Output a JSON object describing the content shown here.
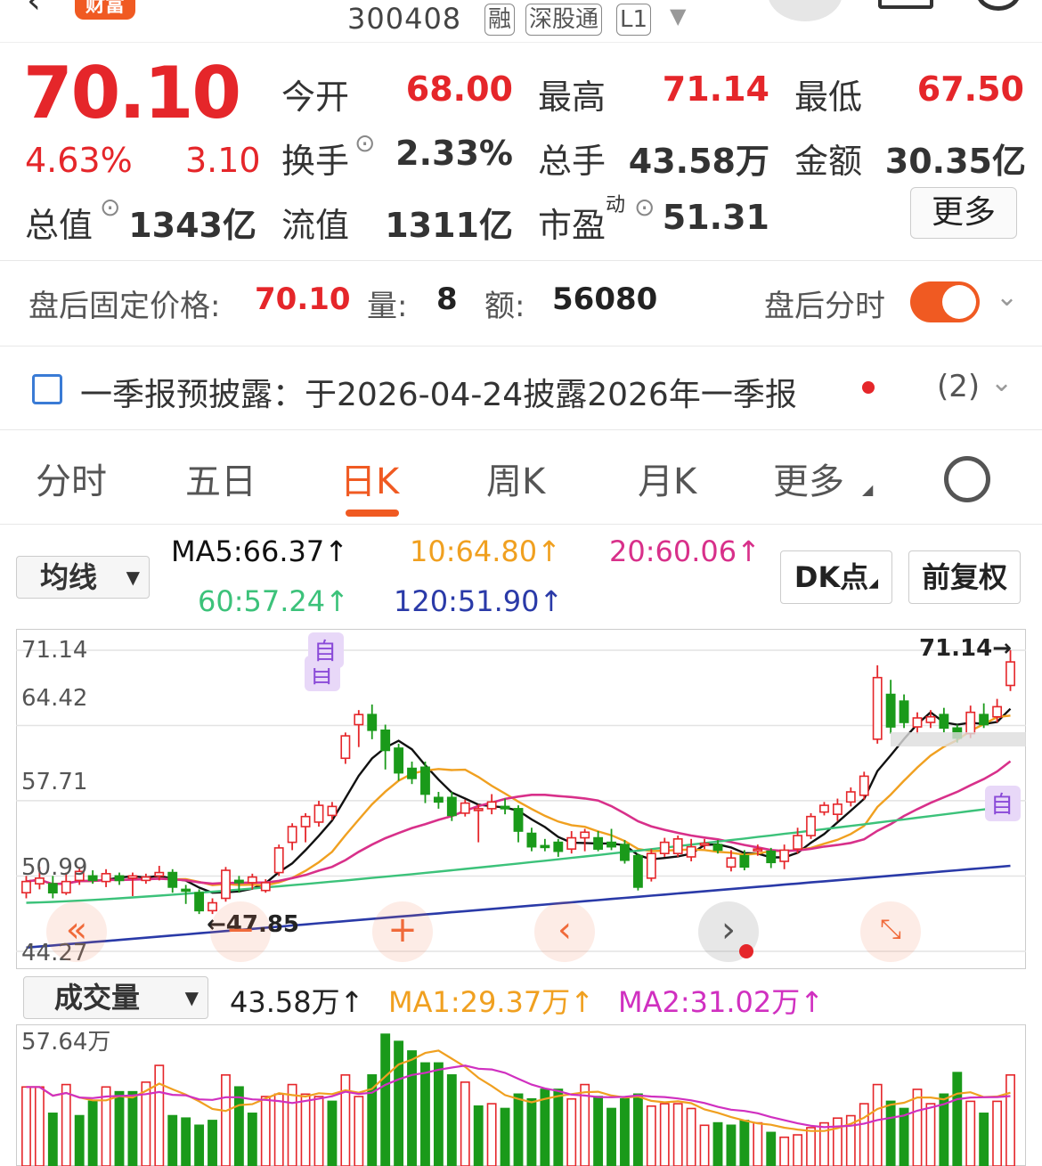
{
  "header": {
    "badge": "财富",
    "stock_code": "300408",
    "tags": [
      "融",
      "深股通",
      "L1"
    ]
  },
  "quote": {
    "price": "70.10",
    "change_pct": "4.63%",
    "change": "3.10",
    "fields": [
      {
        "label": "今开",
        "value": "68.00",
        "color": "red"
      },
      {
        "label": "最高",
        "value": "71.14",
        "color": "red"
      },
      {
        "label": "最低",
        "value": "67.50",
        "color": "red"
      },
      {
        "label": "换手",
        "value": "2.33%",
        "color": "dark"
      },
      {
        "label": "总手",
        "value": "43.58万",
        "color": "dark"
      },
      {
        "label": "金额",
        "value": "30.35亿",
        "color": "dark"
      },
      {
        "label": "总值",
        "value": "1343亿",
        "color": "dark"
      },
      {
        "label": "流值",
        "value": "1311亿",
        "color": "dark"
      },
      {
        "label": "市盈",
        "value": "51.31",
        "color": "dark"
      }
    ],
    "pe_superscript": "动",
    "more_label": "更多"
  },
  "after_hours": {
    "label": "盘后固定价格:",
    "price": "70.10",
    "vol_label": "量:",
    "vol": "8",
    "amount_label": "额:",
    "amount": "56080",
    "timeshare_label": "盘后分时",
    "toggle_on": true
  },
  "notice": {
    "text": "一季报预披露：于2026-04-24披露2026年一季报",
    "count": "(2)"
  },
  "tabs": [
    "分时",
    "五日",
    "日K",
    "周K",
    "月K",
    "更多"
  ],
  "active_tab": "日K",
  "ma_legend": {
    "dropdown": "均线",
    "ma5": "MA5:66.37↑",
    "ma10": "10:64.80↑",
    "ma20": "20:60.06↑",
    "ma60": "60:57.24↑",
    "ma120": "120:51.90↑",
    "dk_label": "DK点",
    "adjust_label": "前复权",
    "colors": {
      "ma5": "#111111",
      "ma10": "#f0a020",
      "ma20": "#d8308a",
      "ma60": "#3cc27a",
      "ma120": "#2a3aa8",
      "up": "#e5262a",
      "down": "#1a9a1a"
    }
  },
  "kchart_labels": {
    "y_ticks": [
      "71.14",
      "64.42",
      "57.71",
      "50.99",
      "44.27"
    ],
    "high_marker": "71.14→",
    "low_marker": "←47.85",
    "self_tag": "自"
  },
  "volume": {
    "dropdown": "成交量",
    "value": "43.58万↑",
    "ma1": "MA1:29.37万↑",
    "ma2": "MA2:31.02万↑",
    "max_label": "57.64万"
  },
  "chart_data": [
    {
      "type": "candlestick",
      "ylim": [
        44.27,
        71.14
      ],
      "y_ticks": [
        71.14,
        64.42,
        57.71,
        50.99,
        44.27
      ],
      "grid": true,
      "candles": [
        [
          49.5,
          50.5,
          49.0,
          51.0
        ],
        [
          50.3,
          50.8,
          49.8,
          51.8
        ],
        [
          50.3,
          49.5,
          49.0,
          51.0
        ],
        [
          49.5,
          50.5,
          49.3,
          51.3
        ],
        [
          50.6,
          51.4,
          50.2,
          51.8
        ],
        [
          51.0,
          50.6,
          50.3,
          51.5
        ],
        [
          50.5,
          51.2,
          50.0,
          51.6
        ],
        [
          51.0,
          50.6,
          50.2,
          51.3
        ],
        [
          50.8,
          51.0,
          49.2,
          51.3
        ],
        [
          50.6,
          50.9,
          50.3,
          51.2
        ],
        [
          51.0,
          51.3,
          50.6,
          51.9
        ],
        [
          51.3,
          50.0,
          49.5,
          51.6
        ],
        [
          49.8,
          49.7,
          48.5,
          50.2
        ],
        [
          49.5,
          47.9,
          47.6,
          49.8
        ],
        [
          47.9,
          48.6,
          47.6,
          49.0
        ],
        [
          49.0,
          51.5,
          48.7,
          51.8
        ],
        [
          50.6,
          50.4,
          49.5,
          51.0
        ],
        [
          50.4,
          50.9,
          49.8,
          51.2
        ],
        [
          49.7,
          50.4,
          49.5,
          50.7
        ],
        [
          51.3,
          53.5,
          51.0,
          53.8
        ],
        [
          54.0,
          55.4,
          53.3,
          55.7
        ],
        [
          55.4,
          56.3,
          54.0,
          56.6
        ],
        [
          55.8,
          57.3,
          55.4,
          57.7
        ],
        [
          56.4,
          57.2,
          56.0,
          57.6
        ],
        [
          61.5,
          63.5,
          61.0,
          63.8
        ],
        [
          64.5,
          65.4,
          62.5,
          65.8
        ],
        [
          65.4,
          64.0,
          63.2,
          66.3
        ],
        [
          64.0,
          62.2,
          60.5,
          64.5
        ],
        [
          62.4,
          60.2,
          59.5,
          62.8
        ],
        [
          60.6,
          59.7,
          59.2,
          61.2
        ],
        [
          60.7,
          58.3,
          57.5,
          61.2
        ],
        [
          58.0,
          57.6,
          57.0,
          58.5
        ],
        [
          58.0,
          56.4,
          55.9,
          58.5
        ],
        [
          56.6,
          57.5,
          56.3,
          57.8
        ],
        [
          56.9,
          57.0,
          54.0,
          57.4
        ],
        [
          57.0,
          57.6,
          56.5,
          58.3
        ],
        [
          57.2,
          57.0,
          56.5,
          57.9
        ],
        [
          57.0,
          55.0,
          54.0,
          57.3
        ],
        [
          54.8,
          53.6,
          53.2,
          55.3
        ],
        [
          53.7,
          53.6,
          53.2,
          54.3
        ],
        [
          54.0,
          53.2,
          52.7,
          54.3
        ],
        [
          53.4,
          54.4,
          53.0,
          55.0
        ],
        [
          54.4,
          54.9,
          53.2,
          55.2
        ],
        [
          54.4,
          53.4,
          53.2,
          55.0
        ],
        [
          54.0,
          53.6,
          53.3,
          55.2
        ],
        [
          53.8,
          52.4,
          52.1,
          54.2
        ],
        [
          52.8,
          50.0,
          49.7,
          53.0
        ],
        [
          50.8,
          53.0,
          50.5,
          53.4
        ],
        [
          53.0,
          54.0,
          52.7,
          54.4
        ],
        [
          53.0,
          54.3,
          52.7,
          54.6
        ],
        [
          52.7,
          53.6,
          52.3,
          54.3
        ],
        [
          53.8,
          53.9,
          53.4,
          54.3
        ],
        [
          53.8,
          53.3,
          53.0,
          54.2
        ],
        [
          51.8,
          52.6,
          51.4,
          53.3
        ],
        [
          52.8,
          51.8,
          51.5,
          53.3
        ],
        [
          53.4,
          53.4,
          52.8,
          53.8
        ],
        [
          53.2,
          52.2,
          51.7,
          53.5
        ],
        [
          52.3,
          53.3,
          51.6,
          53.8
        ],
        [
          53.4,
          54.6,
          53.0,
          55.3
        ],
        [
          54.6,
          56.3,
          54.3,
          56.6
        ],
        [
          56.7,
          57.3,
          56.4,
          57.6
        ],
        [
          56.5,
          57.4,
          55.9,
          57.9
        ],
        [
          57.6,
          58.5,
          57.2,
          58.9
        ],
        [
          58.2,
          59.9,
          57.8,
          60.3
        ],
        [
          63.2,
          68.7,
          62.8,
          69.8
        ],
        [
          67.2,
          64.3,
          63.7,
          68.5
        ],
        [
          66.6,
          64.7,
          64.2,
          67.2
        ],
        [
          64.3,
          65.1,
          63.7,
          65.6
        ],
        [
          64.7,
          65.2,
          64.2,
          65.8
        ],
        [
          65.4,
          64.2,
          63.8,
          66.0
        ],
        [
          64.2,
          63.3,
          62.9,
          64.5
        ],
        [
          63.7,
          65.6,
          63.3,
          66.2
        ],
        [
          65.4,
          64.5,
          64.2,
          66.4
        ],
        [
          65.2,
          66.1,
          64.7,
          66.8
        ],
        [
          68.0,
          70.1,
          67.5,
          71.14
        ]
      ]
    },
    {
      "type": "bar",
      "ylim": [
        0,
        57.64
      ],
      "unit": "万",
      "values": [
        33,
        33,
        22,
        34,
        21,
        27,
        33,
        31,
        31,
        35,
        42,
        21,
        20,
        17,
        19,
        38,
        33,
        22,
        29,
        30,
        34,
        30,
        29,
        27,
        38,
        29,
        38,
        55,
        52,
        48,
        43,
        43,
        38,
        35,
        25,
        26,
        24,
        30,
        28,
        32,
        32,
        28,
        34,
        29,
        24,
        28,
        30,
        25,
        26,
        26,
        24,
        17,
        18,
        17,
        19,
        18,
        14,
        12,
        13,
        16,
        18,
        20,
        21,
        26,
        34,
        27,
        24,
        32,
        26,
        30,
        39,
        27,
        22,
        27,
        38
      ],
      "colors": [
        "up",
        "up",
        "down",
        "up",
        "down",
        "down",
        "up",
        "down",
        "down",
        "up",
        "up",
        "down",
        "down",
        "down",
        "down",
        "up",
        "down",
        "down",
        "up",
        "up",
        "up",
        "up",
        "up",
        "down",
        "up",
        "up",
        "down",
        "down",
        "down",
        "down",
        "down",
        "down",
        "down",
        "up",
        "down",
        "up",
        "down",
        "down",
        "down",
        "down",
        "down",
        "up",
        "up",
        "down",
        "down",
        "down",
        "down",
        "up",
        "up",
        "up",
        "up",
        "up",
        "down",
        "down",
        "down",
        "up",
        "down",
        "up",
        "up",
        "up",
        "up",
        "up",
        "up",
        "up",
        "up",
        "down",
        "down",
        "up",
        "up",
        "down",
        "down",
        "up",
        "down",
        "up",
        "up"
      ]
    }
  ]
}
